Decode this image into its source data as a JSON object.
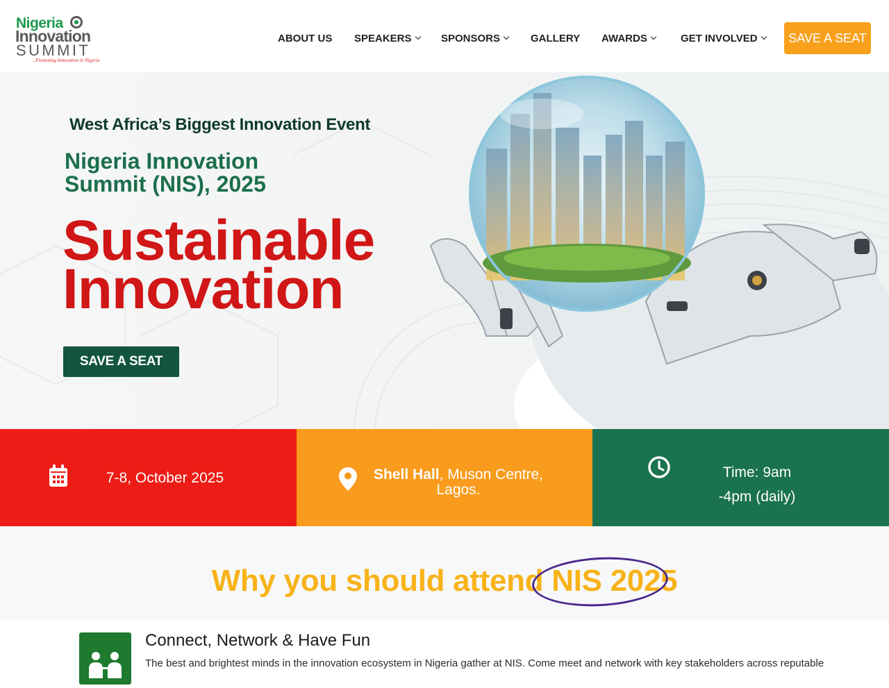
{
  "header": {
    "logo": {
      "line1": "Nigeria",
      "line2": "Innovation",
      "line3": "SUMMIT",
      "tagline": "...Promoting Innovation in Nigeria"
    },
    "nav": [
      {
        "label": "ABOUT US",
        "has_dropdown": false
      },
      {
        "label": "SPEAKERS",
        "has_dropdown": true
      },
      {
        "label": "SPONSORS",
        "has_dropdown": true
      },
      {
        "label": "GALLERY",
        "has_dropdown": false
      },
      {
        "label": "AWARDS",
        "has_dropdown": true
      },
      {
        "label": "GET INVOLVED",
        "has_dropdown": true
      }
    ],
    "cta_label": "SAVE A SEAT"
  },
  "hero": {
    "tagline": "West Africa’s Biggest Innovation Event",
    "event_name": "Nigeria Innovation Summit (NIS), 2025",
    "theme_line1": "Sustainable",
    "theme_line2": "Innovation",
    "cta_label": "SAVE A SEAT"
  },
  "info_bar": {
    "date": {
      "icon": "calendar-icon",
      "text": "7-8, October 2025"
    },
    "venue": {
      "icon": "location-pin-icon",
      "venue_bold": "Shell Hall",
      "venue_rest": ", Muson Centre,",
      "venue_line2": "Lagos."
    },
    "time": {
      "icon": "clock-icon",
      "line1": "Time: 9am",
      "line2": "-4pm (daily)"
    }
  },
  "why": {
    "title_prefix": "Why you should attend ",
    "title_highlight": "NIS 2025"
  },
  "feature": {
    "icon": "network-people-icon",
    "title": "Connect, Network & Have Fun",
    "description": "The best and brightest minds in the innovation ecosystem in Nigeria gather at NIS. Come meet and network with key stakeholders across reputable"
  },
  "colors": {
    "brand_green": "#1a7250",
    "brand_red": "#ee1c16",
    "brand_orange": "#f99b1c",
    "dark_green": "#12553c",
    "why_yellow": "#f8b31a"
  }
}
